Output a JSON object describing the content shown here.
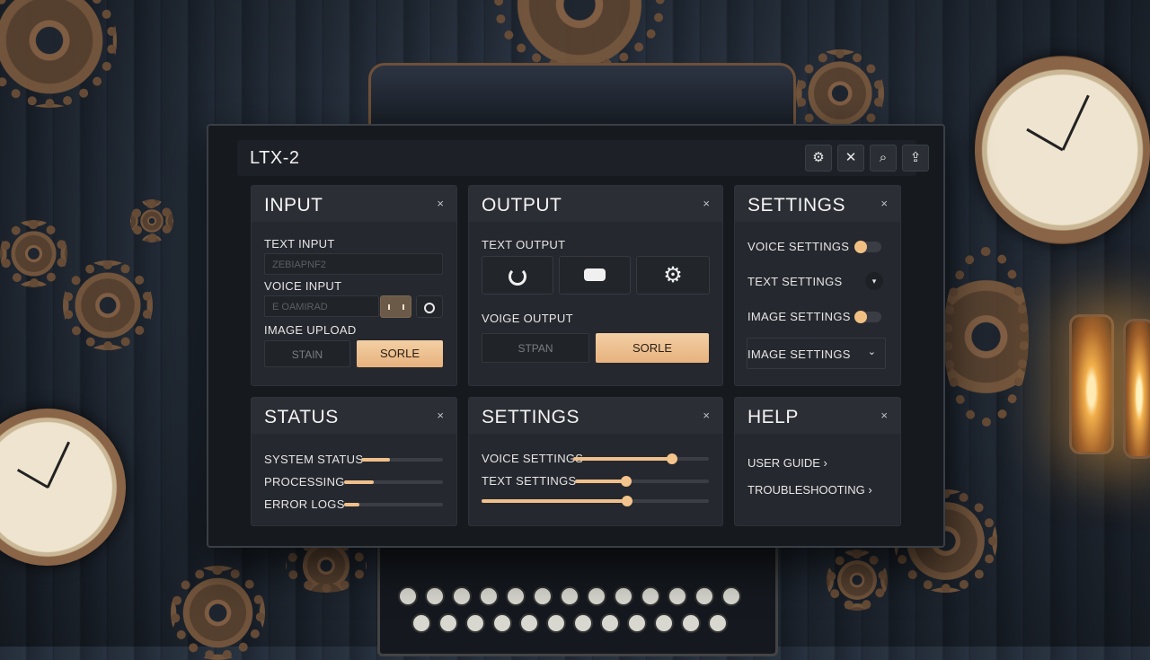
{
  "app": {
    "title": "LTX-2"
  },
  "toolbar": {
    "buttons": [
      {
        "icon": "gear-icon",
        "glyph": "⚙"
      },
      {
        "icon": "tools-icon",
        "glyph": "✕"
      },
      {
        "icon": "search-icon",
        "glyph": "⌕"
      },
      {
        "icon": "share-icon",
        "glyph": "⇪"
      }
    ]
  },
  "input_panel": {
    "title": "INPUT",
    "close": "×",
    "text_input_label": "TEXT INPUT",
    "text_input_value": "ZEBIAPNF2",
    "voice_input_label": "VOICE INPUT",
    "voice_input_value": "E OAMIRAD",
    "image_upload_label": "IMAGE UPLOAD",
    "btn_secondary": "STAIN",
    "btn_primary": "SORLE"
  },
  "output_panel": {
    "title": "OUTPUT",
    "close": "×",
    "text_output_label": "TEXT OUTPUT",
    "voice_output_label": "VOIGE OUTPUT",
    "btn_secondary": "STPAN",
    "btn_primary": "SORLE"
  },
  "settings_panel": {
    "title": "SETTINGS",
    "close": "×",
    "rows": [
      {
        "label": "VOICE SETTINGS"
      },
      {
        "label": "TEXT SETTINGS"
      },
      {
        "label": "IMAGE SETTINGS"
      },
      {
        "label": "IMAGE SETTINGS"
      }
    ]
  },
  "status_panel": {
    "title": "STATUS",
    "close": "×",
    "rows": [
      {
        "label": "SYSTEM STATUS",
        "value": 0.35
      },
      {
        "label": "PROCESSING",
        "value": 0.3
      },
      {
        "label": "ERROR LOGS",
        "value": 0.15
      }
    ]
  },
  "settings_panel_2": {
    "title": "SETTINGS",
    "close": "×",
    "rows": [
      {
        "label": "VOICE SETTINGS",
        "value": 0.73
      },
      {
        "label": "TEXT SETTINGS",
        "value": 0.38
      },
      {
        "label": "",
        "value": 0.64
      }
    ]
  },
  "help_panel": {
    "title": "HELP",
    "close": "×",
    "links": [
      {
        "label": "USER GUIDE ›"
      },
      {
        "label": "TROUBLESHOOTING ›"
      }
    ]
  },
  "colors": {
    "accent": "#f0c08b",
    "panel": "#25282e",
    "window": "#16191e"
  }
}
